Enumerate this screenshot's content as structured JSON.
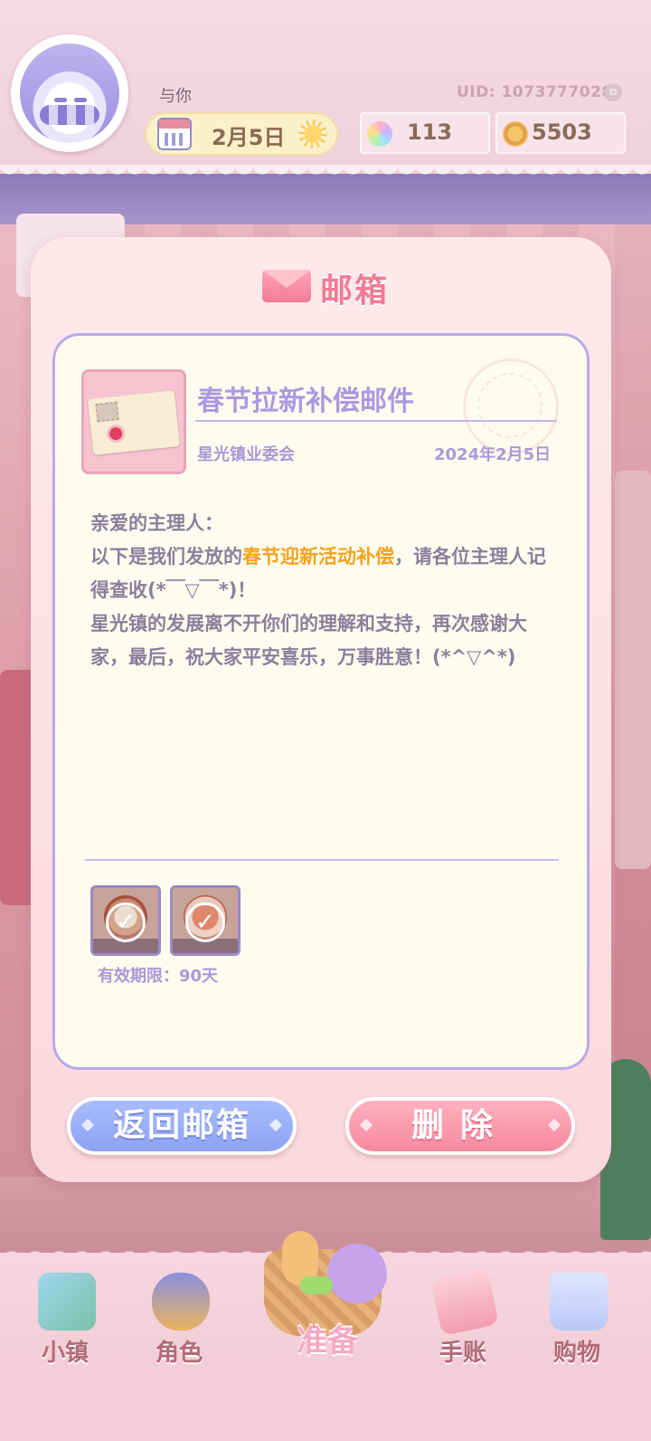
{
  "header": {
    "username": "与你",
    "uid": "UID: 1073777028",
    "date": "2月5日",
    "flowers": "113",
    "coins": "5503"
  },
  "mailbox": {
    "title": "邮箱",
    "mail": {
      "subject": "春节拉新补偿邮件",
      "sender": "星光镇业委会",
      "date": "2024年2月5日",
      "greeting": "亲爱的主理人：",
      "line1_prefix": "以下是我们发放的",
      "line1_highlight": "春节迎新活动补偿",
      "line1_suffix": "，请各位主理人记得查收(*￣▽￣*)！",
      "line2": "星光镇的发展离不开你们的理解和支持，再次感谢大家，最后，祝大家平安喜乐，万事胜意！(*^▽^*)",
      "rewards_claimed": [
        true,
        true
      ],
      "validity": "有效期限：90天"
    },
    "buttons": {
      "back": "返回邮箱",
      "delete": "删除"
    }
  },
  "nav": {
    "items": [
      {
        "label": "小镇"
      },
      {
        "label": "角色"
      },
      {
        "label": "准备"
      },
      {
        "label": "手账"
      },
      {
        "label": "购物"
      }
    ]
  },
  "colors": {
    "accent_pink": "#f07b96",
    "lavender": "#a99be0",
    "highlight": "#f5a21b",
    "back_button": "#8ea2f3",
    "delete_button": "#f7899f"
  }
}
